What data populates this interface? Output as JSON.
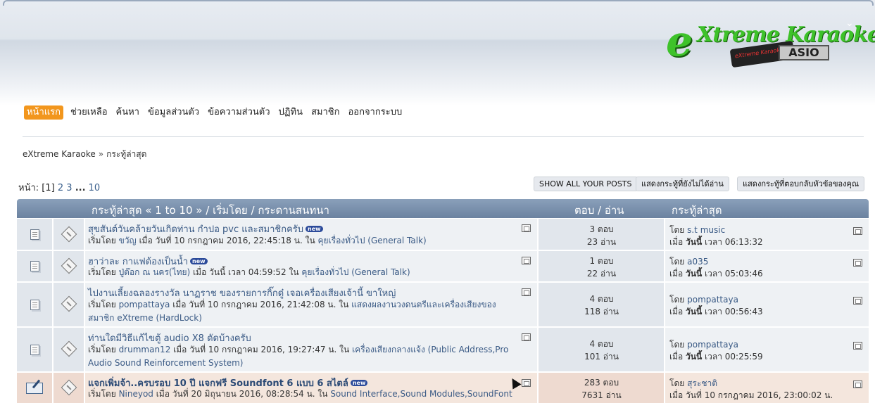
{
  "logo": {
    "text": "eXtreme Karaoke",
    "badge": "ASIO",
    "usb_label": "eXtreme Karaoke"
  },
  "menu": [
    {
      "label": "หน้าแรก",
      "active": true
    },
    {
      "label": "ช่วยเหลือ"
    },
    {
      "label": "ค้นหา"
    },
    {
      "label": "ข้อมูลส่วนตัว"
    },
    {
      "label": "ข้อความส่วนตัว"
    },
    {
      "label": "ปฏิทิน"
    },
    {
      "label": "สมาชิก"
    },
    {
      "label": "ออกจากระบบ"
    }
  ],
  "breadcrumb": {
    "home": "eXtreme Karaoke",
    "separator": "»",
    "current": "กระทู้ล่าสุด"
  },
  "pager": {
    "label": "หน้า:",
    "current": "[1]",
    "pages": [
      "2",
      "3"
    ],
    "ellipsis": "...",
    "last": "10"
  },
  "buttons": {
    "show_all_posts": "SHOW ALL YOUR POSTS",
    "unread_topics": "แสดงกระทู้ที่ยังไม่ได้อ่าน",
    "replies_to_my_topics": "แสดงกระทู้ที่ตอบกลับหัวข้อของคุณ"
  },
  "table_header": {
    "subject": "กระทู้ล่าสุด « 1 to 10 » / เริ่มโดย / กระดานสนทนา",
    "stats": "ตอบ / อ่าน",
    "last_post": "กระทู้ล่าสุด"
  },
  "topics": [
    {
      "title": "สุขสันต์วันคล้ายวันเกิดท่าน กำปอ pvc และสมาชิกครับ",
      "new": "new",
      "meta_prefix": "เริ่มโดย",
      "author": "ขวัญ",
      "date_text": "เมื่อ วันที่ 10 กรกฎาคม 2016, 22:45:18 น. ใน",
      "board": "คุยเรื่องทั่วไป (General Talk)",
      "replies": "3 ตอบ",
      "views": "23 อ่าน",
      "last_by_prefix": "โดย",
      "last_by": "s.t music",
      "last_when_prefix": "เมื่อ",
      "last_when_bold": "วันนี้",
      "last_when_rest": "เวลา 06:13:32"
    },
    {
      "title": "ฮาว่าละ กาแฟต้องเป็นน้ำ",
      "new": "new",
      "meta_prefix": "เริ่มโดย",
      "author": "ปู่ต๊อก ณ นคร(ไทย)",
      "date_text": "เมื่อ วันนี้ เวลา 04:59:52 ใน",
      "board": "คุยเรื่องทั่วไป (General Talk)",
      "replies": "1 ตอบ",
      "views": "22 อ่าน",
      "last_by_prefix": "โดย",
      "last_by": "a035",
      "last_when_prefix": "เมื่อ",
      "last_when_bold": "วันนี้",
      "last_when_rest": "เวลา 05:03:46"
    },
    {
      "title": "ไปงานเลี้ยงฉลองรางวัล นาฏราช ของรายการกิ๊กดู๋ เจอเครื่องเสียงเจ้านี้ ขาใหญ่",
      "new": "",
      "meta_prefix": "เริ่มโดย",
      "author": "pompattaya",
      "date_text": "เมื่อ วันที่ 10 กรกฎาคม 2016, 21:42:08 น. ใน",
      "board": "แสดงผลงานวงดนตรีและเครื่องเสียงของสมาชิก eXtreme (HardLock)",
      "replies": "4 ตอบ",
      "views": "118 อ่าน",
      "last_by_prefix": "โดย",
      "last_by": "pompattaya",
      "last_when_prefix": "เมื่อ",
      "last_when_bold": "วันนี้",
      "last_when_rest": "เวลา 00:56:43"
    },
    {
      "title": "ท่านใดมีวิธีแก้ไขตู้ audio X8 ดัดบ้างครับ",
      "new": "",
      "meta_prefix": "เริ่มโดย",
      "author": "drumman12",
      "date_text": "เมื่อ วันที่ 10 กรกฎาคม 2016, 19:27:47 น. ใน",
      "board": "เครื่องเสียงกลางแจ้ง (Public Address,Pro Audio Sound Reinforcement System)",
      "replies": "4 ตอบ",
      "views": "101 อ่าน",
      "last_by_prefix": "โดย",
      "last_by": "pompattaya",
      "last_when_prefix": "เมื่อ",
      "last_when_bold": "วันนี้",
      "last_when_rest": "เวลา 00:25:59"
    },
    {
      "title": "แจกเพิ่มจ้า..ครบรอบ 10 ปี แจกฟรี Soundfont 6 แบบ 6 สไตล์",
      "new": "new",
      "meta_prefix": "เริ่มโดย",
      "author": "Nineyod",
      "date_text": "เมื่อ วันที่ 20 มิถุนายน 2016, 08:28:54 น. ใน",
      "board": "Sound Interface,Sound Modules,SoundFont",
      "replies": "283 ตอบ",
      "views": "7631 อ่าน",
      "last_by_prefix": "โดย",
      "last_by": "สุระชาติ",
      "last_when_prefix": "เมื่อ",
      "last_when_bold": "",
      "last_when_rest": "วันที่ 10 กรกฎาคม 2016, 23:00:02 น."
    }
  ]
}
